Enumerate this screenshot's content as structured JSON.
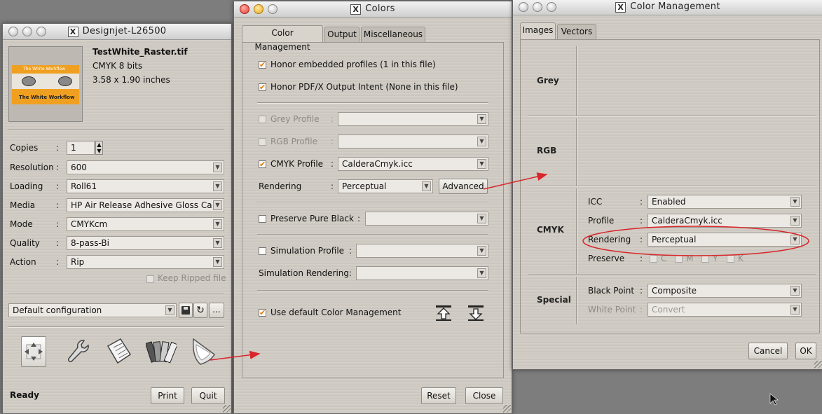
{
  "designjet": {
    "title": "Designjet-L26500",
    "file_name": "TestWhite_Raster.tif",
    "file_mode": "CMYK 8 bits",
    "file_size": "3.58 x 1.90 inches",
    "thumb_caption_top": "The White Workflow",
    "thumb_caption_bottom": "The White Workflow",
    "fields": [
      {
        "label": "Copies",
        "value": "1"
      },
      {
        "label": "Resolution",
        "value": "600"
      },
      {
        "label": "Loading",
        "value": "Roll61"
      },
      {
        "label": "Media",
        "value": "HP Air Release Adhesive Gloss Ca"
      },
      {
        "label": "Mode",
        "value": "CMYKcm"
      },
      {
        "label": "Quality",
        "value": "8-pass-Bi"
      },
      {
        "label": "Action",
        "value": "Rip"
      }
    ],
    "keep_ripped": "Keep Ripped file",
    "configuration": "Default configuration",
    "more_label": "...",
    "status": "Ready",
    "print_label": "Print",
    "quit_label": "Quit"
  },
  "colors": {
    "title": "Colors",
    "tabs": [
      "Color Management",
      "Output",
      "Miscellaneous"
    ],
    "honor_embedded": "Honor embedded profiles (1 in this file)",
    "honor_pdfx": "Honor PDF/X Output Intent (None in this file)",
    "grey_profile": "Grey Profile",
    "rgb_profile": "RGB Profile",
    "cmyk_profile": "CMYK Profile",
    "cmyk_profile_value": "CalderaCmyk.icc",
    "rendering": "Rendering",
    "rendering_value": "Perceptual",
    "advanced_label": "Advanced",
    "preserve_black": "Preserve Pure Black",
    "simulation_profile": "Simulation Profile",
    "simulation_rendering": "Simulation Rendering",
    "use_default": "Use default Color Management",
    "reset_label": "Reset",
    "close_label": "Close"
  },
  "color_management": {
    "title": "Color Management",
    "tabs": [
      "Images",
      "Vectors"
    ],
    "sections": {
      "grey": "Grey",
      "rgb": "RGB",
      "cmyk": "CMYK",
      "special": "Special"
    },
    "icc": "ICC",
    "icc_value": "Enabled",
    "profile": "Profile",
    "profile_value": "CalderaCmyk.icc",
    "rendering": "Rendering",
    "rendering_value": "Perceptual",
    "preserve": "Preserve",
    "preserve_channels": [
      "C",
      "M",
      "Y",
      "K"
    ],
    "black_point": "Black Point",
    "black_point_value": "Composite",
    "white_point": "White Point",
    "white_point_value": "Convert",
    "cancel_label": "Cancel",
    "ok_label": "OK"
  },
  "colors_accent": {
    "checkmark": "#e07a00",
    "annotation": "#d9262a",
    "thumb_orange": "#f0a020"
  }
}
